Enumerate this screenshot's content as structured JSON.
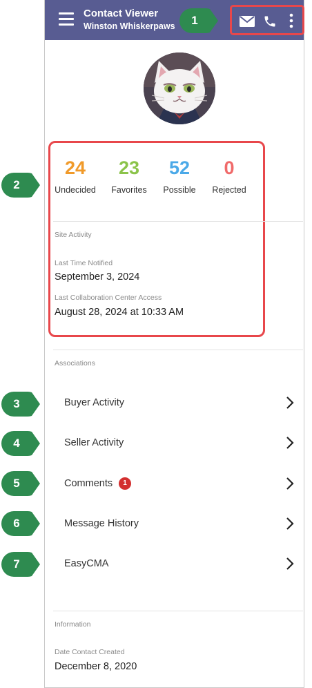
{
  "appbar": {
    "title": "Contact Viewer",
    "subtitle": "Winston Whiskerpaws",
    "background": "#585c92"
  },
  "icons": {
    "menu": "hamburger-icon",
    "mail": "mail-icon",
    "phone": "phone-icon",
    "more": "more-vert-icon"
  },
  "stats": [
    {
      "value": "24",
      "label": "Undecided",
      "color": "#f09a2a"
    },
    {
      "value": "23",
      "label": "Favorites",
      "color": "#8bc34a"
    },
    {
      "value": "52",
      "label": "Possible",
      "color": "#4ba9e8"
    },
    {
      "value": "0",
      "label": "Rejected",
      "color": "#f06a6a"
    }
  ],
  "site_activity": {
    "heading": "Site Activity",
    "last_notified_label": "Last Time Notified",
    "last_notified_value": "September 3, 2024",
    "last_access_label": "Last Collaboration Center Access",
    "last_access_value": "August 28, 2024 at 10:33 AM"
  },
  "associations": {
    "heading": "Associations",
    "items": [
      {
        "label": "Buyer Activity"
      },
      {
        "label": "Seller Activity"
      },
      {
        "label": "Comments",
        "badge": "1"
      },
      {
        "label": "Message History"
      },
      {
        "label": "EasyCMA"
      }
    ]
  },
  "information": {
    "heading": "Information",
    "created_label": "Date Contact Created",
    "created_value": "December 8, 2020"
  },
  "callouts": [
    "1",
    "2",
    "3",
    "4",
    "5",
    "6",
    "7"
  ],
  "colors": {
    "highlight": "#e8474b",
    "callout": "#2e8b50",
    "badge": "#d32f2f"
  }
}
